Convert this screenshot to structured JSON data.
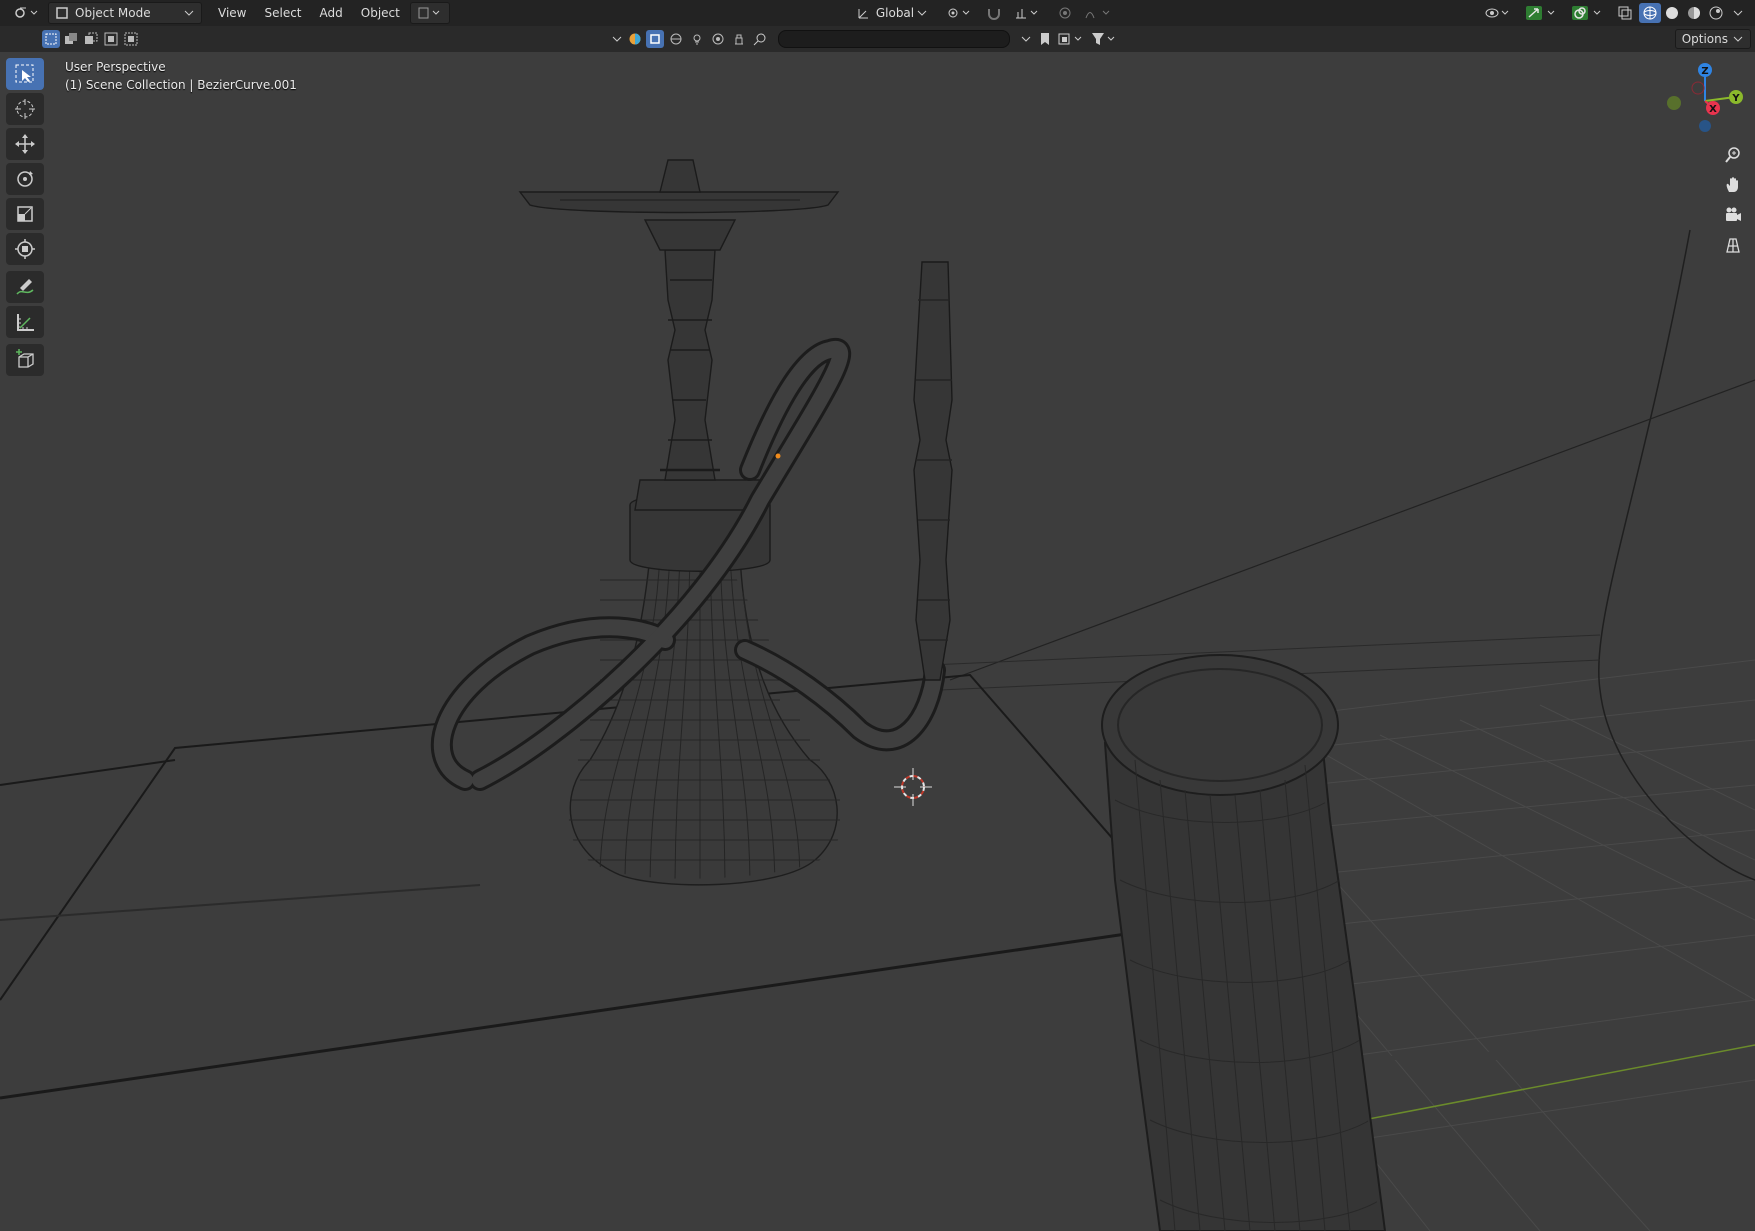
{
  "header": {
    "mode_label": "Object Mode",
    "menus": [
      "View",
      "Select",
      "Add",
      "Object"
    ],
    "transform_orientation": "Global",
    "options_label": "Options"
  },
  "viewport": {
    "view_name": "User Perspective",
    "collection_info": "(1) Scene Collection | BezierCurve.001"
  },
  "gizmo": {
    "z": "Z",
    "y": "Y",
    "x": "X"
  },
  "tools": [
    "select-box",
    "cursor",
    "move",
    "rotate",
    "scale",
    "transform",
    "annotate",
    "measure",
    "add-cube"
  ],
  "colors": {
    "accent": "#4772b3",
    "bg": "#3d3d3d",
    "header": "#232323",
    "x_axis": "#e8344e",
    "y_axis": "#8bb92b",
    "z_axis": "#2f84e3"
  }
}
